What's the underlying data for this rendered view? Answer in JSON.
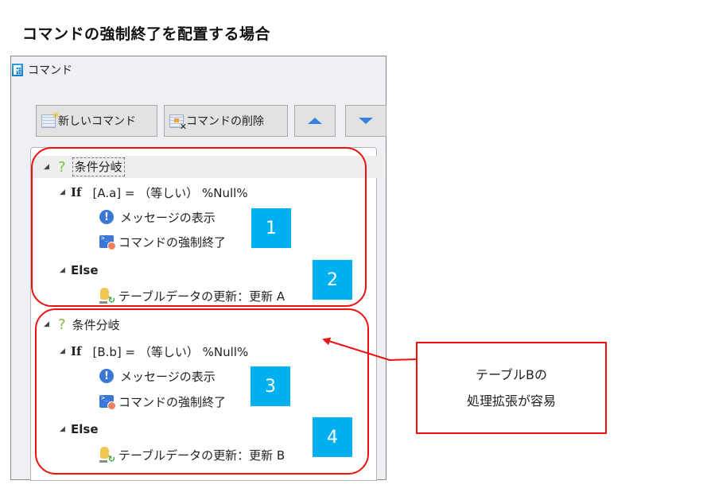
{
  "heading": "コマンドの強制終了を配置する場合",
  "window": {
    "title": "コマンド",
    "icon": "app-f-grid-icon"
  },
  "toolbar": {
    "new_command_label": "新しいコマンド",
    "new_command_icon": "new-grid-icon",
    "delete_command_label": "コマンドの削除",
    "delete_command_icon": "delete-grid-icon",
    "move_up_icon": "triangle-up-icon",
    "move_down_icon": "triangle-down-icon"
  },
  "tree": {
    "groups": [
      {
        "branch_label": "条件分岐",
        "if_keyword": "If",
        "if_condition": "[A.a] = （等しい） %Null%",
        "if_children": [
          "メッセージの表示",
          "コマンドの強制終了"
        ],
        "else_keyword": "Else",
        "else_children": [
          "テーブルデータの更新：更新 A"
        ]
      },
      {
        "branch_label": "条件分岐",
        "if_keyword": "If",
        "if_condition": "[B.b] = （等しい） %Null%",
        "if_children": [
          "メッセージの表示",
          "コマンドの強制終了"
        ],
        "else_keyword": "Else",
        "else_children": [
          "テーブルデータの更新：更新 B"
        ]
      }
    ]
  },
  "badges": [
    "1",
    "2",
    "3",
    "4"
  ],
  "callout": {
    "line1": "テーブルBの",
    "line2": "処理拡張が容易"
  },
  "colors": {
    "annotation_red": "#ee1111",
    "badge_blue": "#00b0f0",
    "icon_blue": "#3a78d8",
    "question_green": "#7cc13f"
  }
}
